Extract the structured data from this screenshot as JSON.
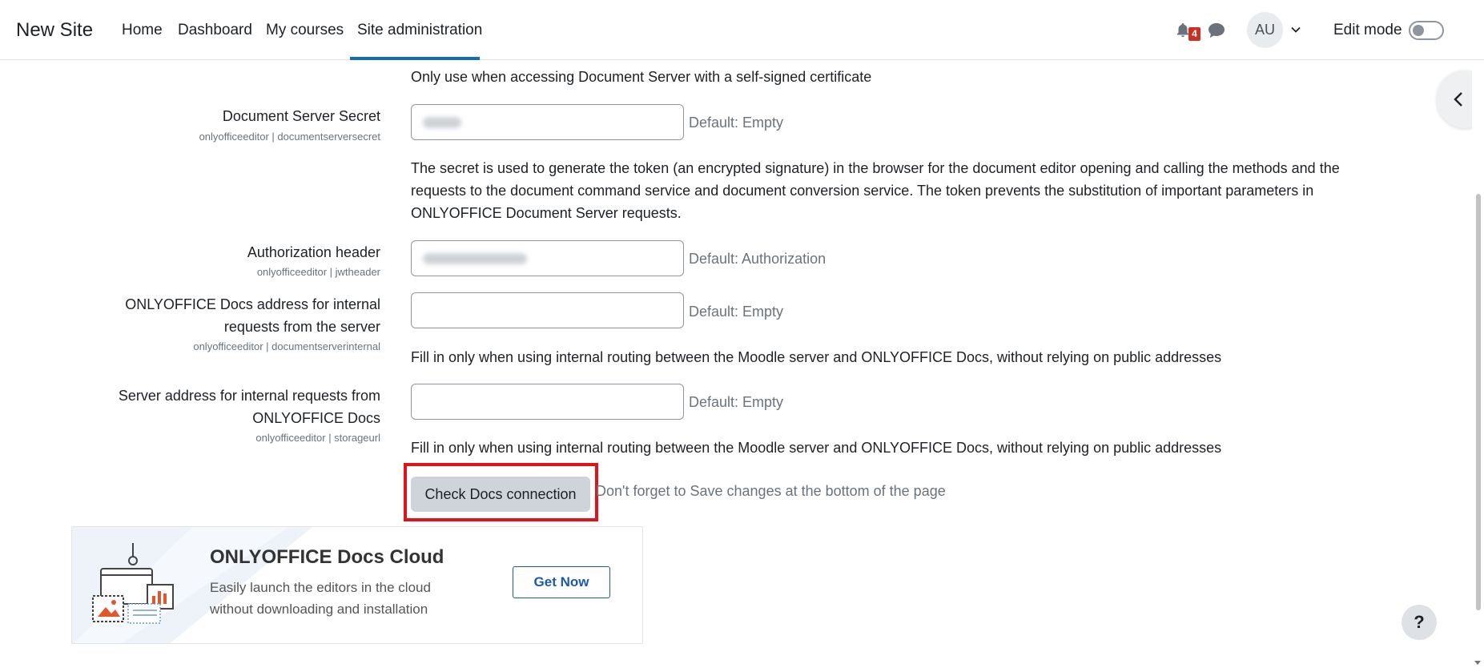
{
  "navbar": {
    "brand": "New Site",
    "links": [
      "Home",
      "Dashboard",
      "My courses",
      "Site administration"
    ],
    "active_link": "Site administration",
    "notification_count": "4",
    "avatar_initials": "AU",
    "edit_mode_label": "Edit mode",
    "edit_mode_on": false
  },
  "settings": {
    "cert_note": "Only use when accessing Document Server with a self-signed certificate",
    "secret": {
      "label": "Document Server Secret",
      "sublabel": "onlyofficeeditor | documentserversecret",
      "default": "Default: Empty",
      "description_lines": [
        "The secret is used to generate the token (an encrypted signature) in the browser for the document editor opening and calling the methods and the",
        "requests to the document command service and document conversion service. The token prevents the substitution of important parameters in",
        "ONLYOFFICE Document Server requests."
      ]
    },
    "auth_header": {
      "label": "Authorization header",
      "sublabel": "onlyofficeeditor | jwtheader",
      "default": "Default: Authorization"
    },
    "internal_address": {
      "label_lines": [
        "ONLYOFFICE Docs address for internal",
        "requests from the server"
      ],
      "sublabel": "onlyofficeeditor | documentserverinternal",
      "value": "",
      "default": "Default: Empty",
      "description": "Fill in only when using internal routing between the Moodle server and ONLYOFFICE Docs, without relying on public addresses"
    },
    "storage_url": {
      "label_lines": [
        "Server address for internal requests from",
        "ONLYOFFICE Docs"
      ],
      "sublabel": "onlyofficeeditor | storageurl",
      "value": "",
      "default": "Default: Empty",
      "description": "Fill in only when using internal routing between the Moodle server and ONLYOFFICE Docs, without relying on public addresses"
    },
    "check_button_label": "Check Docs connection",
    "save_note": "Don't forget to Save changes at the bottom of the page"
  },
  "banner": {
    "title": "ONLYOFFICE Docs Cloud",
    "text_lines": [
      "Easily launch the editors in the cloud",
      "without downloading and installation"
    ],
    "button_label": "Get Now"
  },
  "help_label": "?",
  "colors": {
    "accent": "#0f6cbf",
    "badge": "#ca3120",
    "highlight_frame": "#e0121a",
    "button_bg": "#ced4da",
    "banner_button": "#1c5aa8"
  }
}
